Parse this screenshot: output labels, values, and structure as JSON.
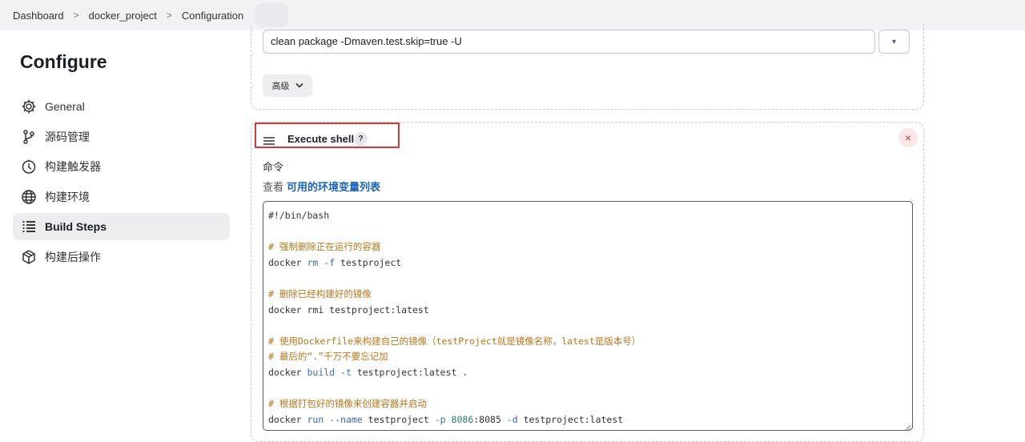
{
  "breadcrumb": {
    "items": [
      "Dashboard",
      "docker_project",
      "Configuration"
    ],
    "separator": ">"
  },
  "sidebar": {
    "title": "Configure",
    "items": [
      {
        "label": "General",
        "icon": "gear-icon",
        "active": false
      },
      {
        "label": "源码管理",
        "icon": "source-branch-icon",
        "active": false
      },
      {
        "label": "构建触发器",
        "icon": "timer-icon",
        "active": false
      },
      {
        "label": "构建环境",
        "icon": "globe-icon",
        "active": false
      },
      {
        "label": "Build Steps",
        "icon": "list-icon",
        "active": true
      },
      {
        "label": "构建后操作",
        "icon": "package-icon",
        "active": false
      }
    ]
  },
  "maven_step": {
    "goals_value": "clean package -Dmaven.test.skip=true -U",
    "expand_icon": "▾",
    "advanced_label": "高级",
    "advanced_icon": "chevron-down-icon"
  },
  "shell_step": {
    "title": "Execute shell",
    "help": "?",
    "close": "×",
    "command_label": "命令",
    "env_prefix": "查看",
    "env_link": "可用的环境变量列表",
    "code_lines": [
      "#!/bin/bash",
      "",
      "# 强制删除正在运行的容器",
      "docker rm -f testproject",
      "",
      "# 删除已经构建好的镜像",
      "docker rmi testproject:latest",
      "",
      "# 使用Dockerfile来构建自己的镜像（testProject就是镜像名称，latest是版本号）",
      "# 最后的“.”千万不要忘记加",
      "docker build -t testproject:latest .",
      "",
      "# 根据打包好的镜像来创建容器并启动",
      "docker run --name testproject -p 8086:8085 -d testproject:latest"
    ]
  },
  "colors": {
    "accent_link": "#1a63b8",
    "highlight_border": "#d33a3a",
    "comment": "#b3771d",
    "active_nav_bg": "#ededf0"
  }
}
